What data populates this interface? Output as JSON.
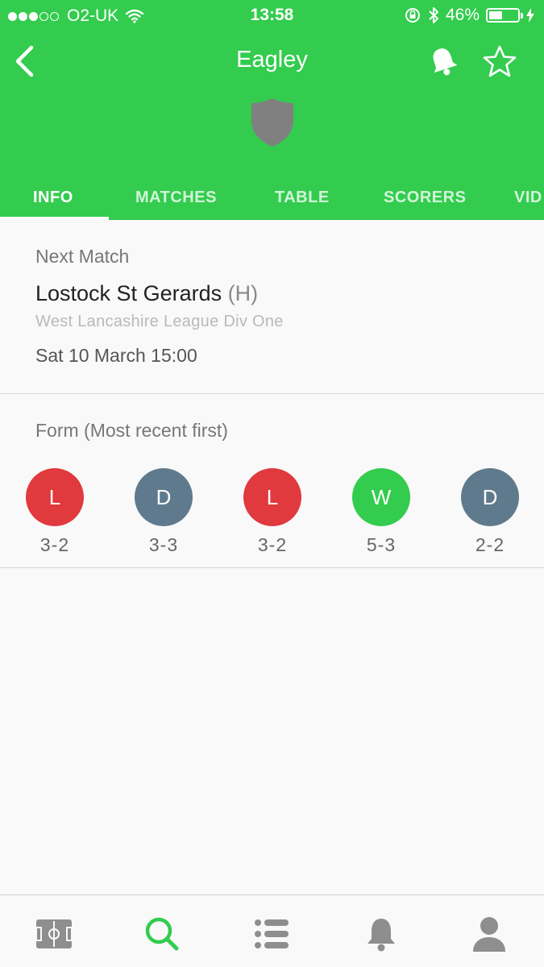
{
  "status_bar": {
    "carrier": "O2-UK",
    "time": "13:58",
    "battery": "46%",
    "battery_level": 0.46
  },
  "header": {
    "title": "Eagley",
    "back_icon": "chevron-left-icon",
    "notifications_icon": "bell-icon",
    "favourite_icon": "star-outline-icon",
    "crest_icon": "shield-icon"
  },
  "tabs": [
    {
      "label": "INFO",
      "active": true
    },
    {
      "label": "MATCHES",
      "active": false
    },
    {
      "label": "TABLE",
      "active": false
    },
    {
      "label": "SCORERS",
      "active": false
    },
    {
      "label": "VID",
      "active": false
    }
  ],
  "next_match": {
    "heading": "Next Match",
    "opponent": "Lostock St Gerards",
    "venue": "(H)",
    "league": "West Lancashire League Div One",
    "datetime": "Sat 10 March 15:00"
  },
  "form": {
    "heading": "Form (Most recent first)",
    "results": [
      {
        "result": "L",
        "score": "3-2"
      },
      {
        "result": "D",
        "score": "3-3"
      },
      {
        "result": "L",
        "score": "3-2"
      },
      {
        "result": "W",
        "score": "5-3"
      },
      {
        "result": "D",
        "score": "2-2"
      }
    ]
  },
  "bottom_nav": [
    {
      "icon": "pitch-icon",
      "active": false
    },
    {
      "icon": "search-icon",
      "active": true
    },
    {
      "icon": "list-icon",
      "active": false
    },
    {
      "icon": "bell-icon",
      "active": false
    },
    {
      "icon": "user-icon",
      "active": false
    }
  ],
  "colors": {
    "brand_green": "#33cc4e",
    "loss": "#e0393e",
    "draw": "#5f7a8c",
    "win": "#33cc4e",
    "inactive_icon": "#8e8e8e"
  }
}
